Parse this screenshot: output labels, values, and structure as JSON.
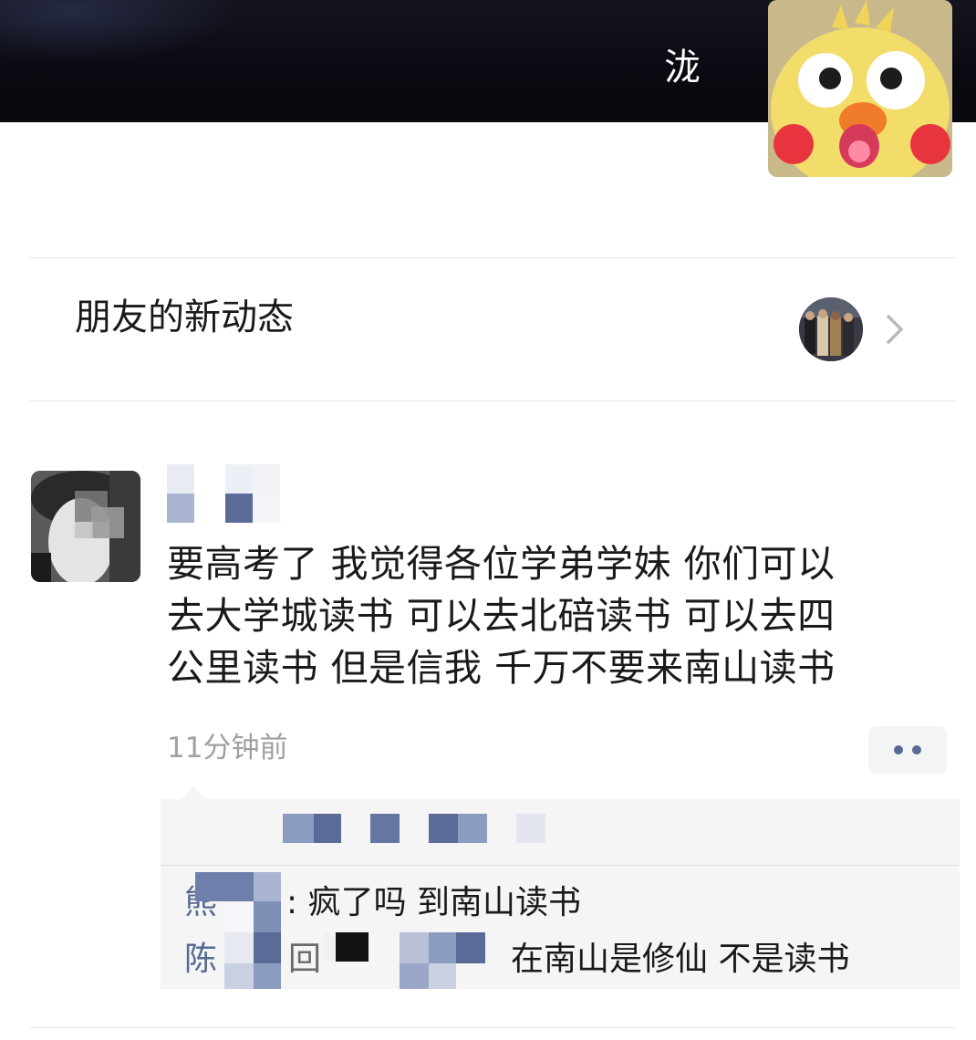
{
  "profile": {
    "name": "泷",
    "avatar_icon": "yellow-chick-avatar-icon"
  },
  "friends_updates": {
    "label": "朋友的新动态",
    "thumbnail_icon": "group-photo-icon",
    "chevron_icon": "chevron-right-icon"
  },
  "post": {
    "author_name_hidden": true,
    "text_lines": [
      "要高考了 我觉得各位学弟学妹 你们可以",
      "去大学城读书 可以去北碚读书 可以去四",
      "公里读书 但是信我 千万不要来南山读书"
    ],
    "time": "11分钟前",
    "more_icon": "more-dots-icon"
  },
  "comments": [
    {
      "name_visible": "熊",
      "text": ": 疯了吗  到南山读书"
    },
    {
      "name_visible": "陈",
      "reply_visible": "回",
      "text": "在南山是修仙 不是读书"
    }
  ],
  "colors": {
    "name_link": "#586a93",
    "time": "#a0a0a0",
    "comment_bg": "#f5f5f5"
  }
}
